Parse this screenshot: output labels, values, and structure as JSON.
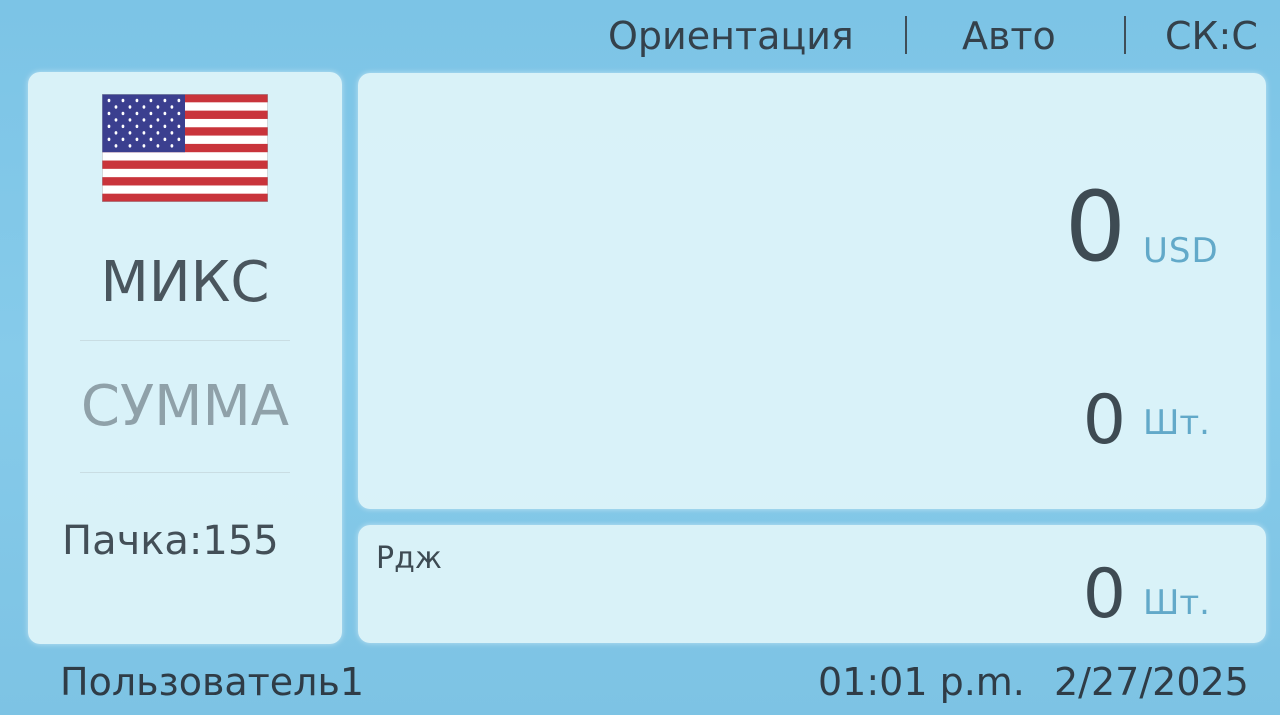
{
  "header": {
    "orientation_label": "Ориентация",
    "mode_label": "Авто",
    "sk_label": "СК:С"
  },
  "left_panel": {
    "flag_icon": "us-flag-icon",
    "mix_label": "МИКС",
    "sum_label": "СУММА",
    "batch_label": "Пачка:155"
  },
  "main_panel": {
    "amount": "0",
    "currency": "USD",
    "count": "0",
    "count_unit": "Шт."
  },
  "reject_panel": {
    "label": "Рдж",
    "count": "0",
    "unit": "Шт."
  },
  "footer": {
    "user": "Пользователь1",
    "time": "01:01 p.m.",
    "date": "2/27/2025"
  },
  "colors": {
    "background": "#7cc4e6",
    "panel": "#e1f5fa",
    "accent_unit": "#62a9c9"
  }
}
